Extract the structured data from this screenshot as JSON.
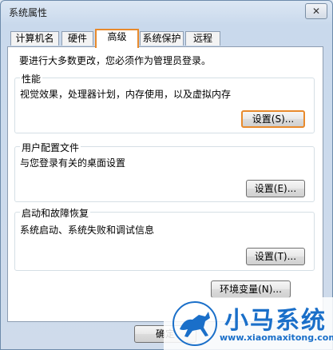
{
  "window": {
    "title": "系统属性",
    "close_glyph": "✕"
  },
  "tabs": [
    {
      "label": "计算机名"
    },
    {
      "label": "硬件"
    },
    {
      "label": "高级"
    },
    {
      "label": "系统保护"
    },
    {
      "label": "远程"
    }
  ],
  "advanced": {
    "notice": "要进行大多数更改，您必须作为管理员登录。",
    "performance": {
      "label": "性能",
      "desc": "视觉效果，处理器计划，内存使用，以及虚拟内存",
      "button": "设置(S)..."
    },
    "profiles": {
      "label": "用户配置文件",
      "desc": "与您登录有关的桌面设置",
      "button": "设置(E)..."
    },
    "startup": {
      "label": "启动和故障恢复",
      "desc": "系统启动、系统失败和调试信息",
      "button": "设置(T)..."
    },
    "env_button": "环境变量(N)..."
  },
  "footer": {
    "ok_button": "确定"
  },
  "watermark": {
    "name": "小马系统",
    "url": "www.xiaomaxitong.com"
  },
  "colors": {
    "highlight": "#e88a2c",
    "brand": "#1a6fc9"
  }
}
